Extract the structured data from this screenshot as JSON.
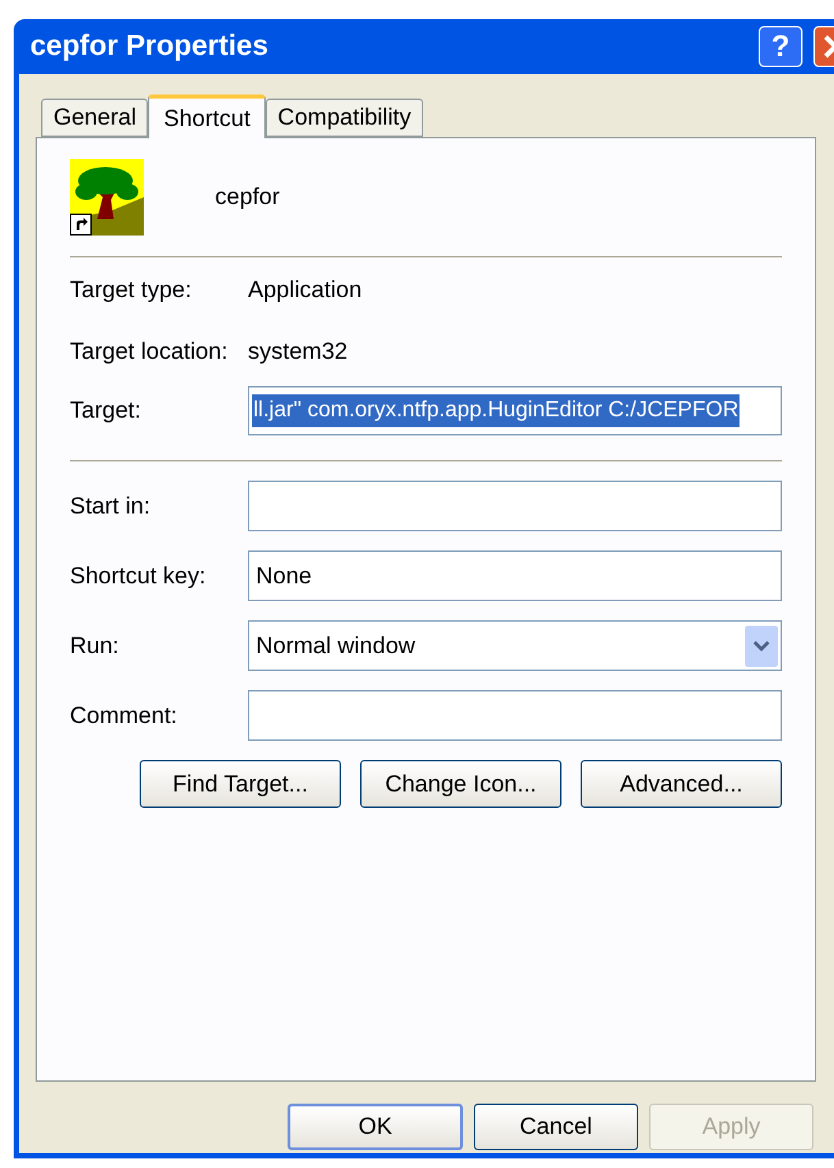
{
  "window": {
    "title": "cepfor Properties",
    "help_button": "?"
  },
  "tabs": [
    {
      "label": "General",
      "selected": false
    },
    {
      "label": "Shortcut",
      "selected": true
    },
    {
      "label": "Compatibility",
      "selected": false
    }
  ],
  "shortcut_name": "cepfor",
  "info": [
    {
      "label": "Target type:",
      "value": "Application"
    },
    {
      "label": "Target location:",
      "value": "system32"
    }
  ],
  "target": {
    "label": "Target:",
    "value": "ll.jar\" com.oryx.ntfp.app.HuginEditor C:/JCEPFOR",
    "selected": true
  },
  "fields": [
    {
      "kind": "text",
      "label": "Start in:"
    },
    {
      "kind": "text",
      "label": "Shortcut key:",
      "value": "None"
    },
    {
      "kind": "dropdown",
      "label": "Run:",
      "value": "Normal window"
    },
    {
      "kind": "text",
      "label": "Comment:"
    }
  ],
  "action_buttons": [
    {
      "label": "Find Target..."
    },
    {
      "label": "Change Icon..."
    },
    {
      "label": "Advanced..."
    }
  ],
  "dialog_buttons": [
    {
      "label": "OK",
      "default": true,
      "disabled": false
    },
    {
      "label": "Cancel",
      "default": false,
      "disabled": false
    },
    {
      "label": "Apply",
      "default": false,
      "disabled": true
    }
  ]
}
